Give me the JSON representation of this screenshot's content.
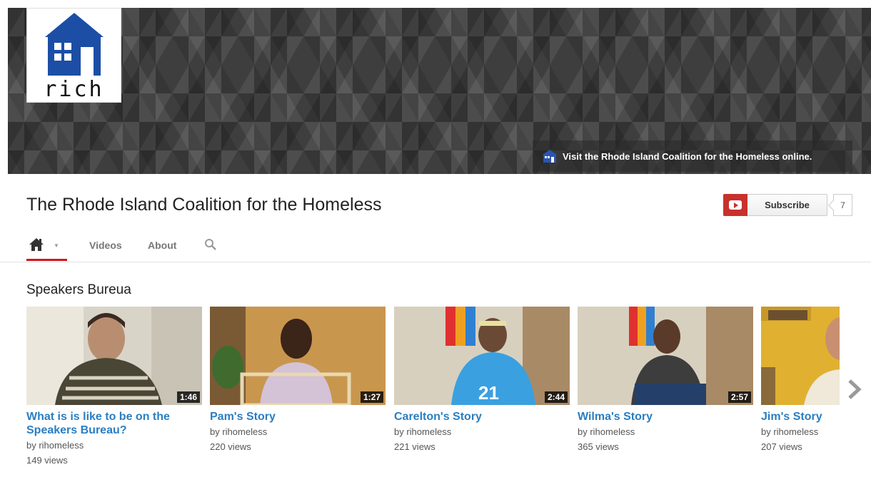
{
  "banner": {
    "logo_text": "rich",
    "link_text": "Visit the Rhode Island Coalition for the Homeless online."
  },
  "channel": {
    "title": "The Rhode Island Coalition for the Homeless",
    "subscribe_label": "Subscribe",
    "subscriber_count": "7"
  },
  "tabs": {
    "home_icon": "home-icon",
    "videos": "Videos",
    "about": "About",
    "search_icon": "search-icon"
  },
  "section": {
    "title": "Speakers Bureua"
  },
  "videos": [
    {
      "title": "What is is like to be on the Speakers Bureau?",
      "by": "by rihomeless",
      "views": "149 views",
      "duration": "1:46"
    },
    {
      "title": "Pam's Story",
      "by": "by rihomeless",
      "views": "220 views",
      "duration": "1:27"
    },
    {
      "title": "Carelton's Story",
      "by": "by rihomeless",
      "views": "221 views",
      "duration": "2:44"
    },
    {
      "title": "Wilma's Story",
      "by": "by rihomeless",
      "views": "365 views",
      "duration": "2:57"
    },
    {
      "title": "Jim's Story",
      "by": "by rihomeless",
      "views": "207 views",
      "duration": ""
    }
  ],
  "colors": {
    "link_blue": "#2a7ec1",
    "youtube_red": "#c8312c",
    "logo_blue": "#1c4ea6"
  }
}
